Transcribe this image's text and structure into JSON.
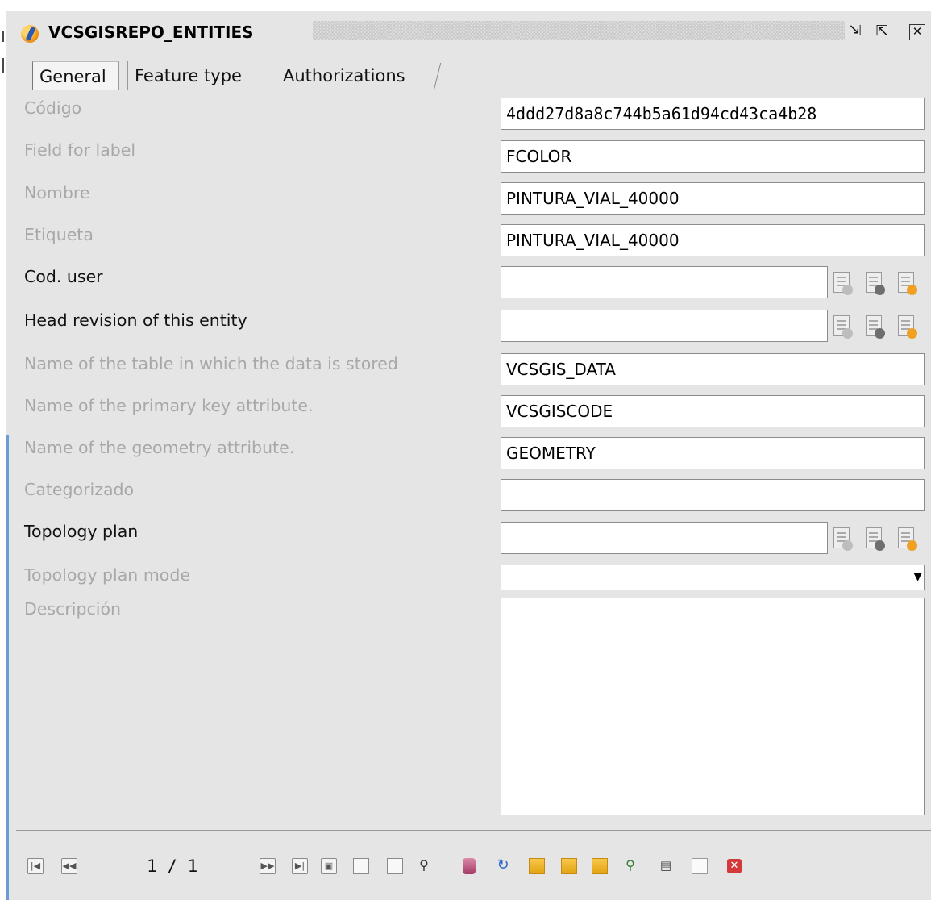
{
  "window": {
    "title": "VCSGISREPO_ENTITIES",
    "buttons": {
      "restore": "⇲",
      "maximize": "⇱",
      "close": "✕"
    }
  },
  "tabs": [
    {
      "label": "General",
      "active": true
    },
    {
      "label": "Feature type",
      "active": false
    },
    {
      "label": "Authorizations",
      "active": false
    }
  ],
  "form": {
    "codigo": {
      "label": "Código",
      "value": "4ddd27d8a8c744b5a61d94cd43ca4b28"
    },
    "field_for_label": {
      "label": "Field for label",
      "value": "FCOLOR"
    },
    "nombre": {
      "label": "Nombre",
      "value": "PINTURA_VIAL_40000"
    },
    "etiqueta": {
      "label": "Etiqueta",
      "value": "PINTURA_VIAL_40000"
    },
    "cod_user": {
      "label": "Cod. user",
      "value": ""
    },
    "head_revision": {
      "label": "Head revision of this entity",
      "value": ""
    },
    "table_name": {
      "label": "Name of the table in which the data is stored",
      "value": "VCSGIS_DATA"
    },
    "primary_key": {
      "label": "Name of the primary key attribute.",
      "value": "VCSGISCODE"
    },
    "geometry_attr": {
      "label": "Name of the geometry attribute.",
      "value": "GEOMETRY"
    },
    "categorizado": {
      "label": "Categorizado",
      "value": ""
    },
    "topology_plan": {
      "label": "Topology plan",
      "value": ""
    },
    "topology_plan_mode": {
      "label": "Topology plan mode",
      "value": ""
    },
    "descripcion": {
      "label": "Descripción",
      "value": ""
    }
  },
  "toolbar": {
    "page_counter": "1 / 1",
    "icons": [
      "first-record-icon",
      "previous-record-icon",
      "next-record-icon",
      "last-record-icon",
      "save-icon",
      "new-record-icon",
      "delete-record-icon",
      "search-icon",
      "database-icon",
      "refresh-icon",
      "add-layer-icon",
      "filter-layer-icon",
      "layer-grid-icon",
      "zoom-to-icon",
      "export-icon",
      "report-icon",
      "close-form-icon"
    ]
  },
  "colors": {
    "background": "#e5e5e5",
    "disabled_label": "#a8a8a8",
    "enabled_label": "#111111",
    "close_icon_red": "#d43a3a",
    "accent_orange": "#f0a022"
  }
}
